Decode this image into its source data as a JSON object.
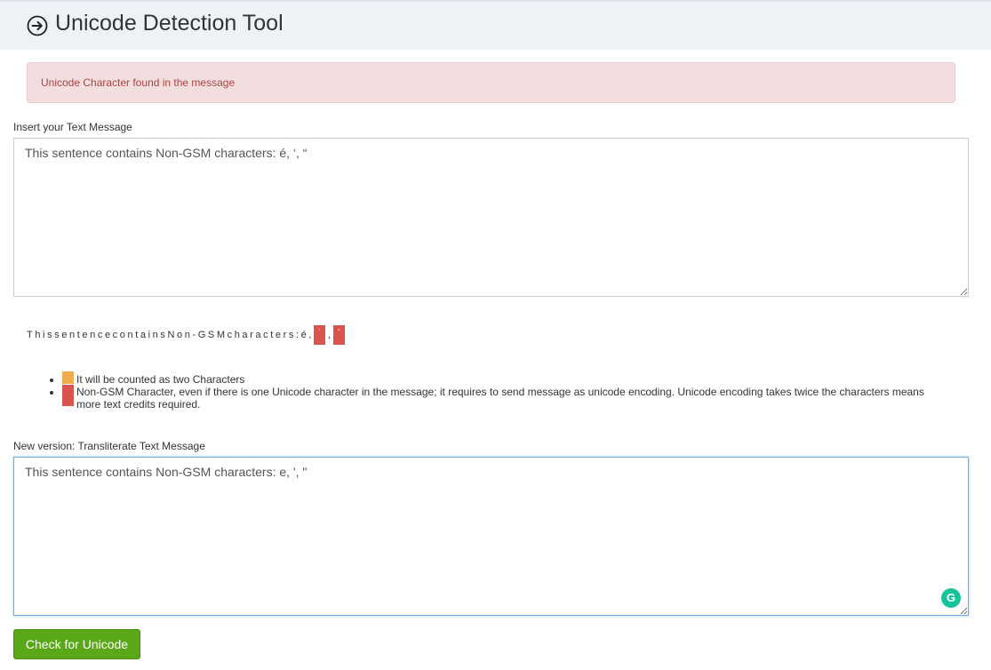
{
  "header": {
    "title": "Unicode Detection Tool",
    "icon": "arrow-right-circle-icon"
  },
  "alert": {
    "text": "Unicode Character found in the message",
    "color": "#a94442",
    "background": "#f2dede"
  },
  "input": {
    "label": "Insert your Text Message",
    "value": "This sentence contains Non-GSM characters: é, ‘, “"
  },
  "analysis": {
    "chars": [
      "T",
      "h",
      "i",
      "s",
      "s",
      "e",
      "n",
      "t",
      "e",
      "n",
      "c",
      "e",
      "c",
      "o",
      "n",
      "t",
      "a",
      "i",
      "n",
      "s",
      "N",
      "o",
      "n",
      "-",
      "G",
      "S",
      "M",
      "c",
      "h",
      "a",
      "r",
      "a",
      "c",
      "t",
      "e",
      "r",
      "s",
      ":",
      "é",
      ","
    ],
    "flagged": [
      "‘",
      ",",
      "“"
    ]
  },
  "legend": {
    "items": [
      {
        "swatch_color": "#f0ad4e",
        "text": "It will be counted as two Characters"
      },
      {
        "swatch_color": "#d9534f",
        "text": "Non-GSM Character, even if there is one Unicode character in the message; it requires to send message as unicode encoding. Unicode encoding takes twice the characters means more text credits required."
      }
    ]
  },
  "output": {
    "label": "New version: Transliterate Text Message",
    "value": "This sentence contains Non-GSM characters: e, ', \""
  },
  "button": {
    "label": "Check for Unicode",
    "color": "#5aa817"
  }
}
